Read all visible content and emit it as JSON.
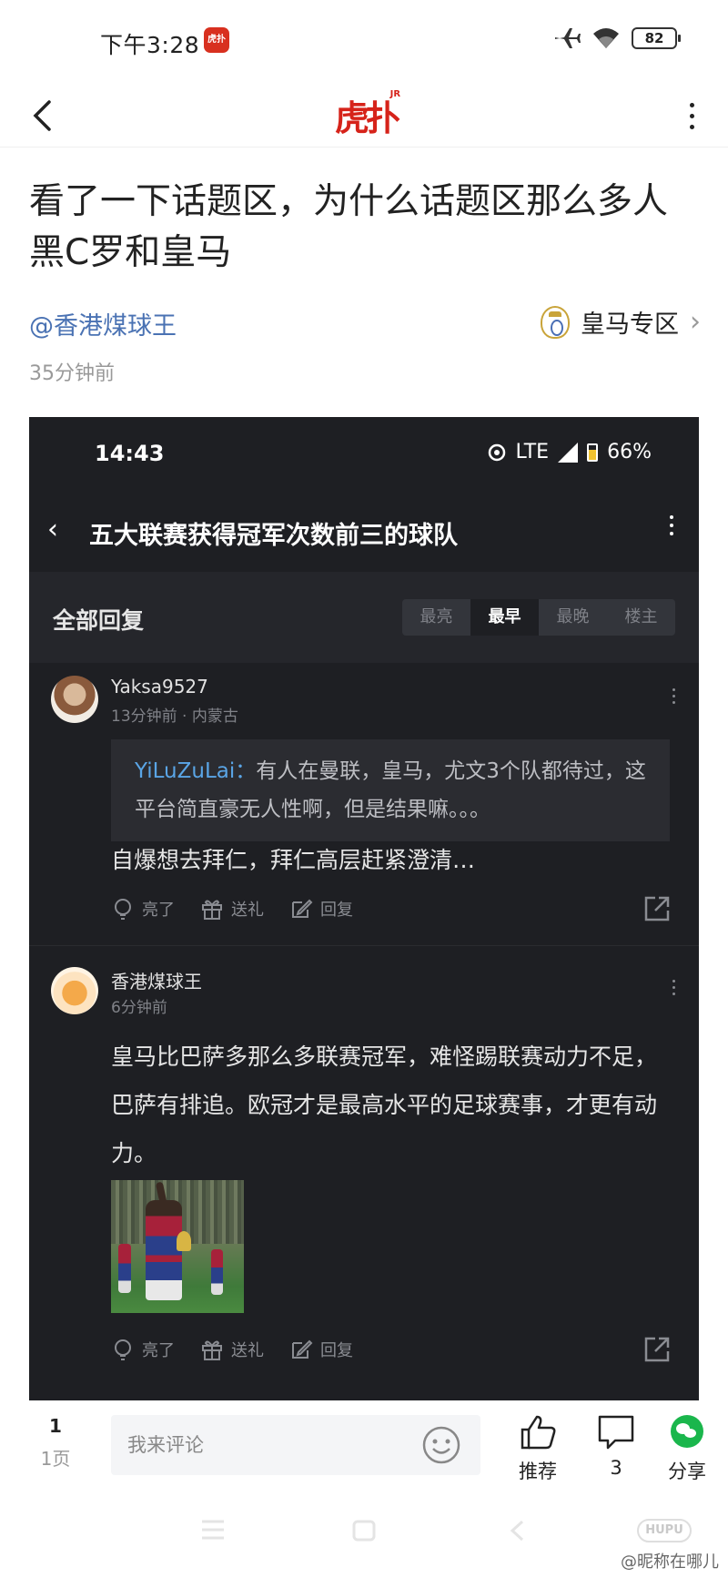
{
  "status_bar": {
    "time": "下午3:28",
    "app_icon_label": "虎扑",
    "battery": "82"
  },
  "header": {
    "logo_text": "虎扑",
    "logo_badge": "JR",
    "back_icon": "chevron-left-icon",
    "more_icon": "more-vertical-icon"
  },
  "post": {
    "title": "看了一下话题区，为什么话题区那么多人黑C罗和皇马",
    "author": "@香港煤球王",
    "board": "皇马专区",
    "time": "35分钟前"
  },
  "embedded_screenshot": {
    "status": {
      "time": "14:43",
      "network": "LTE",
      "battery": "66%"
    },
    "header_title": "五大联赛获得冠军次数前三的球队",
    "filter_label": "全部回复",
    "sort_tabs": [
      "最亮",
      "最早",
      "最晚",
      "楼主"
    ],
    "active_sort": "最早",
    "comments": [
      {
        "username": "Yaksa9527",
        "meta": "13分钟前 · 内蒙古",
        "quote_user": "YiLuZuLai：",
        "quote_text": "有人在曼联，皇马，尤文3个队都待过，这平台简直豪无人性啊，但是结果嘛。。。",
        "text": "自爆想去拜仁，拜仁高层赶紧澄清…",
        "actions": {
          "light": "亮了",
          "gift": "送礼",
          "reply": "回复"
        }
      },
      {
        "username": "香港煤球王",
        "meta": "6分钟前",
        "text": "皇马比巴萨多那么多联赛冠军，难怪踢联赛动力不足，巴萨有排追。欧冠才是最高水平的足球赛事，才更有动力。",
        "actions": {
          "light": "亮了",
          "gift": "送礼",
          "reply": "回复"
        }
      }
    ]
  },
  "bottom_bar": {
    "page_number": "1",
    "page_label": "1页",
    "comment_placeholder": "我来评论",
    "recommend_label": "推荐",
    "comment_count": "3",
    "share_label": "分享"
  },
  "watermark": {
    "logo": "HUPU",
    "text": "@昵称在哪儿"
  },
  "colors": {
    "brand_red": "#d6231a",
    "link_blue": "#4a72b3",
    "dark_bg": "#1e1f23",
    "quote_name": "#5aa5e6",
    "wechat_green": "#1ab64c"
  }
}
